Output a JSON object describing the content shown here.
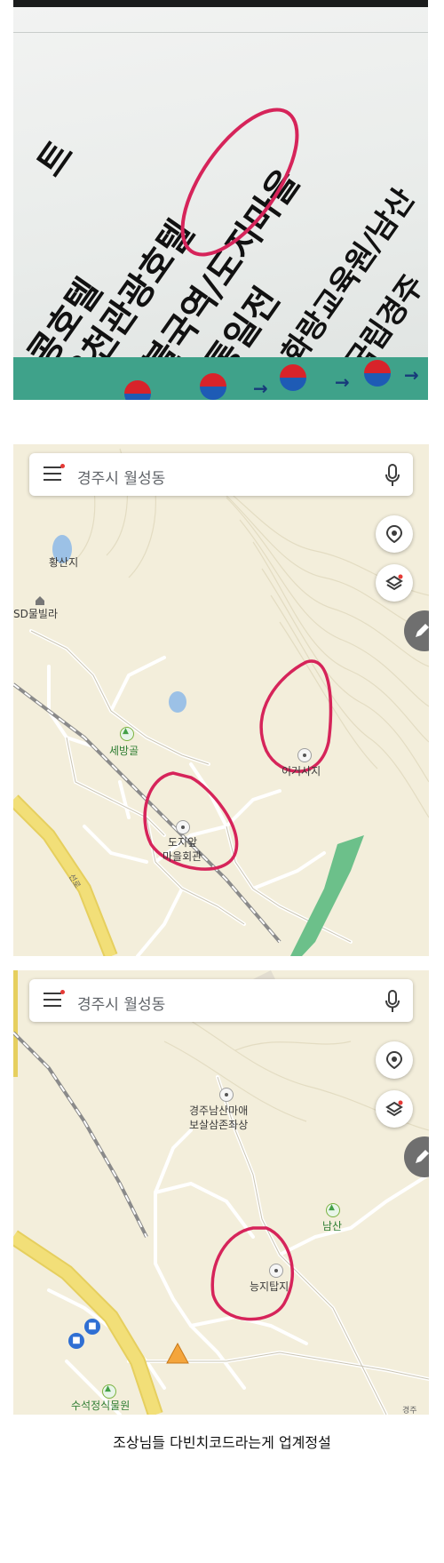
{
  "sign": {
    "lines": [
      "트",
      "콩호텔",
      "온천관광호텔",
      "불국역/도지마을",
      "통일전",
      "화랑교육원/남산",
      "국립경주"
    ]
  },
  "map1": {
    "search": {
      "query": "경주시 월성동"
    },
    "labels": {
      "pond": "황산지",
      "villa": "SD물빌라",
      "valley": "세방골",
      "temple_site": "이거사지",
      "village_hall_line1": "도지앞",
      "village_hall_line2": "마을회관",
      "road": "선로"
    }
  },
  "map2": {
    "search": {
      "query": "경주시 월성동"
    },
    "labels": {
      "buddha_line1": "경주남산마애",
      "buddha_line2": "보살삼존좌상",
      "mountain": "남산",
      "pagoda": "능지탑지",
      "park": "수석정식물원",
      "corner": "경주"
    }
  },
  "caption": "조상님들 다빈치코드라는게 업계정설",
  "colors": {
    "circle": "#d6245a",
    "map_bg": "#f3eedb",
    "rail": "#8a8a8a",
    "highway": "#f2df78",
    "park_green": "#6cc08a"
  }
}
